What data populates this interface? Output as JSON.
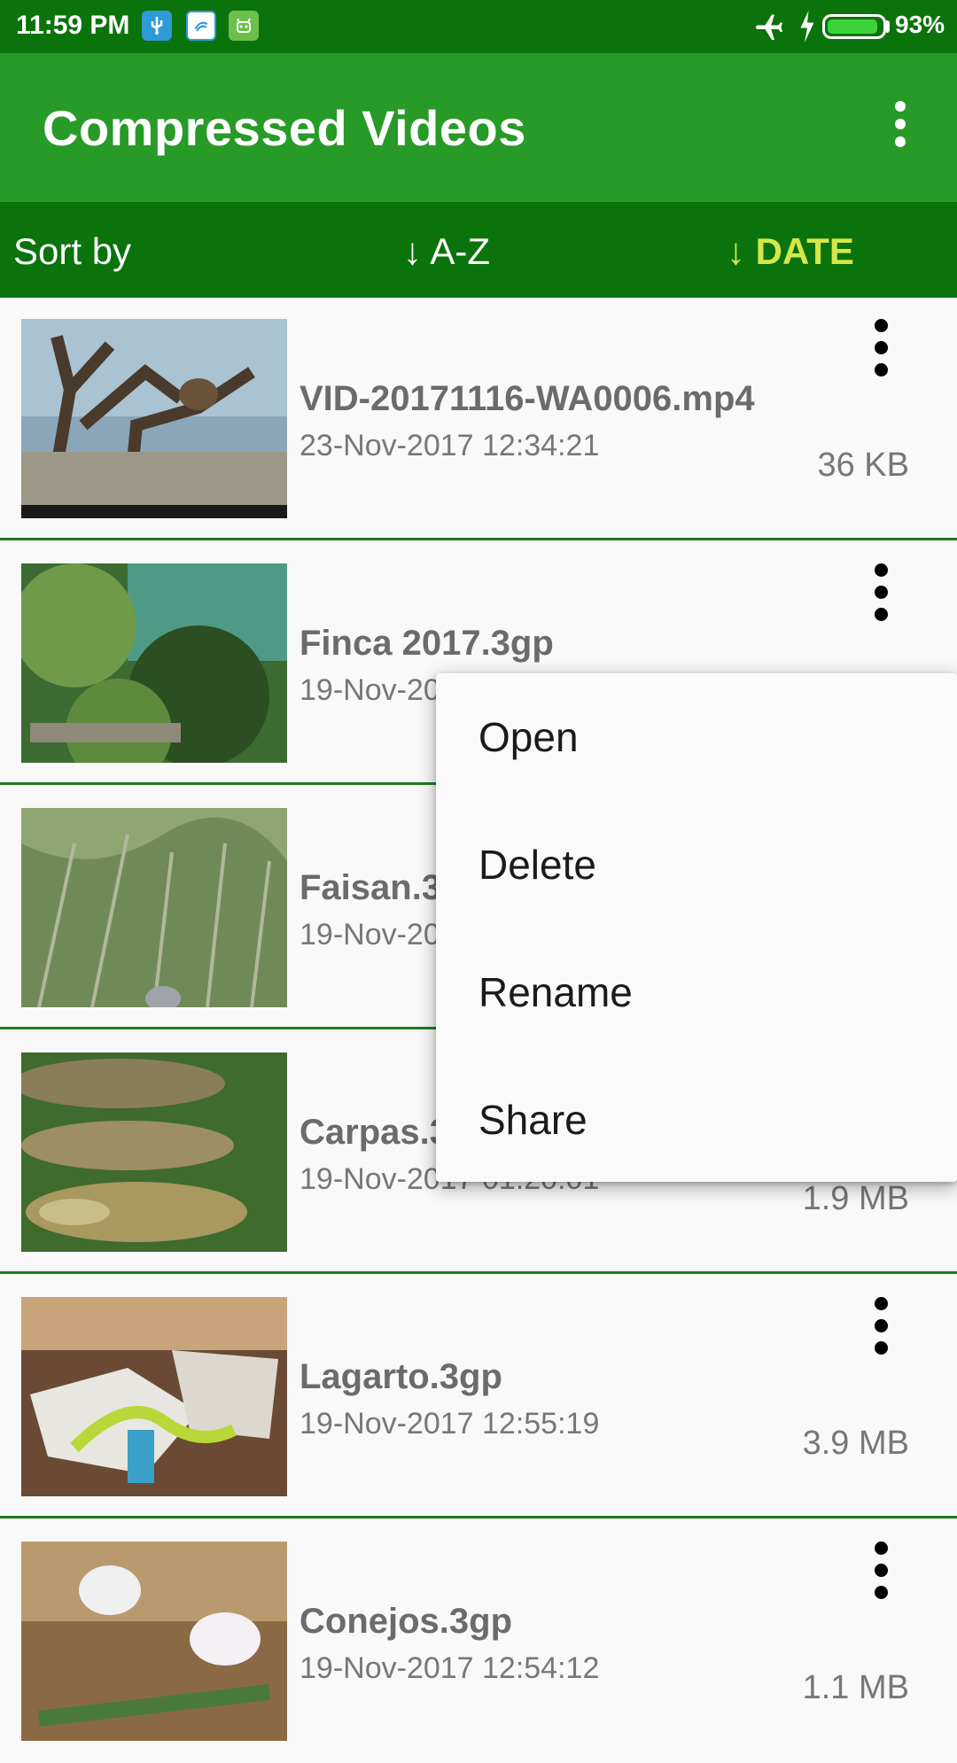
{
  "status_bar": {
    "time": "11:59 PM",
    "battery_percent": "93%",
    "battery_level": 0.93
  },
  "app_bar": {
    "title": "Compressed Videos"
  },
  "sort_bar": {
    "label": "Sort by",
    "option_az": "↓ A-Z",
    "option_date": "↓ DATE",
    "active_color": "#d4e84a"
  },
  "videos": [
    {
      "name": "VID-20171116-WA0006.mp4",
      "date": "23-Nov-2017 12:34:21",
      "size": "36 KB"
    },
    {
      "name": "Finca 2017.3gp",
      "date": "19-Nov-20",
      "size": ""
    },
    {
      "name": "Faisan.3",
      "date": "19-Nov-20",
      "size": ""
    },
    {
      "name": "Carpas.3",
      "date": "19-Nov-2017 01:20:01",
      "size": "1.9 MB"
    },
    {
      "name": "Lagarto.3gp",
      "date": "19-Nov-2017 12:55:19",
      "size": "3.9 MB"
    },
    {
      "name": "Conejos.3gp",
      "date": "19-Nov-2017 12:54:12",
      "size": "1.1 MB"
    }
  ],
  "popup_menu": {
    "items": [
      "Open",
      "Delete",
      "Rename",
      "Share"
    ]
  },
  "colors": {
    "status_bar": "#0b730b",
    "app_bar": "#279a27",
    "sort_bar": "#0b730b",
    "divider": "#1f7a1f"
  }
}
